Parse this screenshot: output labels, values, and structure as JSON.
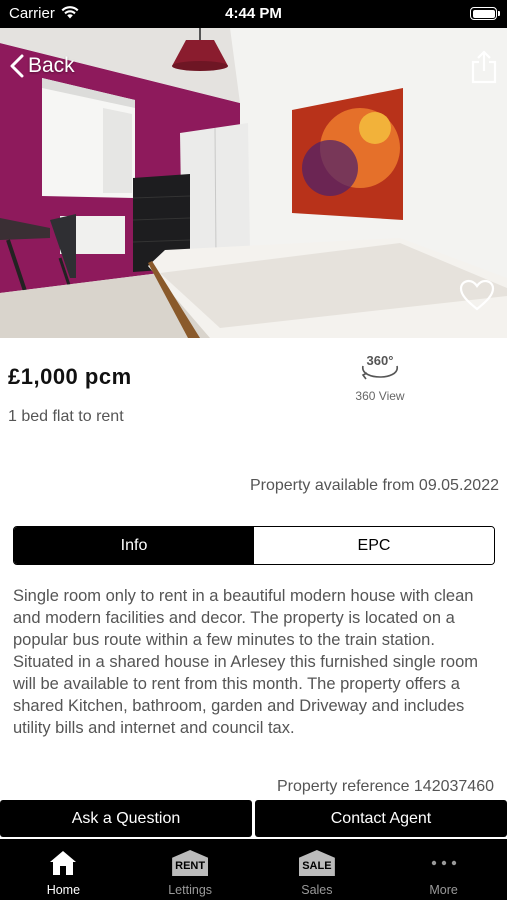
{
  "status_bar": {
    "carrier": "Carrier",
    "time": "4:44 PM"
  },
  "header": {
    "back_label": "Back"
  },
  "listing": {
    "price": "£1,000 pcm",
    "subtitle": "1 bed flat to rent",
    "view360_label": "360 View",
    "available": "Property available from 09.05.2022",
    "description": "Single room only to rent in a beautiful modern house with clean and modern facilities and decor. The property is located on a popular bus route within a few minutes to the train station. Situated in a shared house in Arlesey this furnished single room will be available to rent from this month. The property offers a shared Kitchen, bathroom, garden and Driveway and includes utility bills and internet and council tax.",
    "reference": "Property reference 142037460"
  },
  "tabs": [
    {
      "label": "Info",
      "active": true
    },
    {
      "label": "EPC",
      "active": false
    }
  ],
  "actions": {
    "ask": "Ask a Question",
    "contact": "Contact Agent"
  },
  "tabbar": {
    "home": "Home",
    "lettings": "Lettings",
    "lettings_badge": "RENT",
    "sales": "Sales",
    "sales_badge": "SALE",
    "more": "More"
  },
  "icons": {
    "back": "chevron-left-icon",
    "share": "share-icon",
    "favourite": "heart-icon",
    "view360": "rotate-360-icon",
    "home": "house-icon",
    "more": "ellipsis-icon"
  },
  "colors": {
    "accent": "#000000",
    "wall": "#8e1a5c",
    "text": "#555555"
  }
}
